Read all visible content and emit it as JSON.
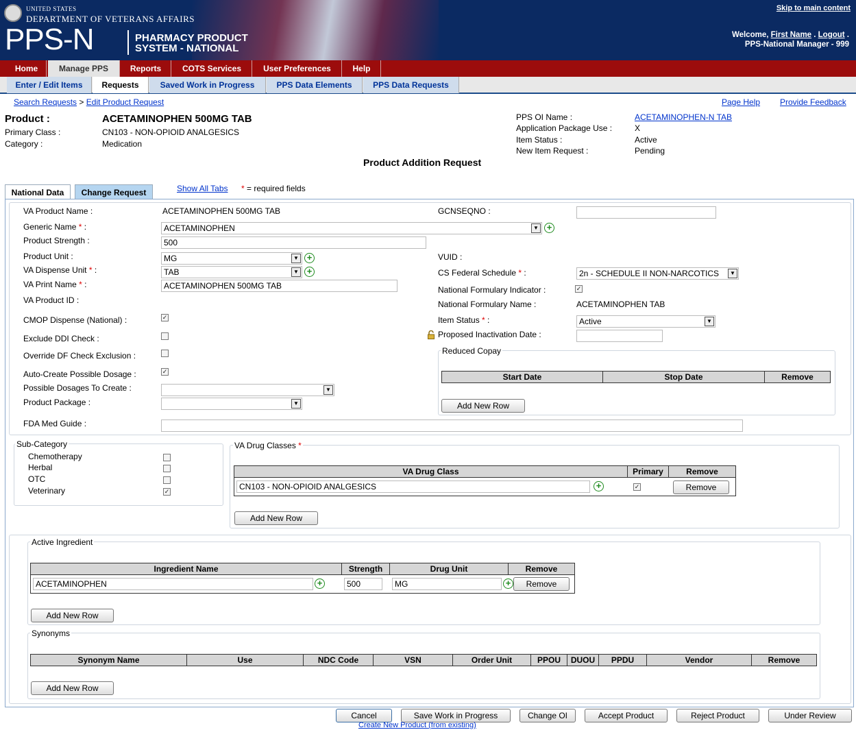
{
  "header": {
    "skip": "Skip to main content",
    "agency_small": "UNITED STATES",
    "agency": "DEPARTMENT OF VETERANS AFFAIRS",
    "logo": "PPS-N",
    "logo_sub1": "PHARMACY PRODUCT",
    "logo_sub2": "SYSTEM - NATIONAL",
    "welcome": "Welcome,",
    "user": "First Name",
    "logout": "Logout",
    "role": "PPS-National Manager - 999"
  },
  "nav": {
    "main": [
      "Home",
      "Manage PPS",
      "Reports",
      "COTS Services",
      "User Preferences",
      "Help"
    ],
    "sub": [
      "Enter / Edit Items",
      "Requests",
      "Saved Work in Progress",
      "PPS Data Elements",
      "PPS Data Requests"
    ]
  },
  "breadcrumb": {
    "link1": "Search Requests",
    "sep": ">",
    "link2": "Edit Product Request"
  },
  "links": {
    "help": "Page Help",
    "feedback": "Provide Feedback"
  },
  "product": {
    "label": "Product :",
    "name": "ACETAMINOPHEN 500MG TAB",
    "primary_class_label": "Primary Class :",
    "primary_class": "CN103 - NON-OPIOID ANALGESICS",
    "category_label": "Category :",
    "category": "Medication",
    "oi_name_label": "PPS OI Name :",
    "oi_name": "ACETAMINOPHEN-N TAB",
    "app_pkg_label": "Application Package Use :",
    "app_pkg": "X",
    "item_status_label": "Item Status :",
    "item_status": "Active",
    "new_item_label": "New Item Request :",
    "new_item": "Pending"
  },
  "page_title": "Product Addition Request",
  "tabs": {
    "national": "National Data",
    "change": "Change Request",
    "show_all": "Show All Tabs",
    "required_star": "*",
    "required_text": " = required fields"
  },
  "form": {
    "va_product_name_label": "VA Product Name :",
    "va_product_name": "ACETAMINOPHEN 500MG TAB",
    "generic_name_label": "Generic Name",
    "generic_name": "ACETAMINOPHEN",
    "product_strength_label": "Product Strength :",
    "product_strength": "500",
    "product_unit_label": "Product Unit :",
    "product_unit": "MG",
    "dispense_unit_label": "VA Dispense Unit",
    "dispense_unit": "TAB",
    "print_name_label": "VA Print Name",
    "print_name": "ACETAMINOPHEN 500MG TAB",
    "product_id_label": "VA Product ID :",
    "cmop_label": "CMOP Dispense (National) :",
    "exclude_ddi_label": "Exclude DDI Check :",
    "override_df_label": "Override DF Check Exclusion :",
    "auto_create_label": "Auto-Create Possible Dosage :",
    "possible_dosages_label": "Possible Dosages To Create :",
    "product_package_label": "Product Package :",
    "fda_label": "FDA Med Guide :",
    "gcnseqno_label": "GCNSEQNO :",
    "vuid_label": "VUID :",
    "cs_label": "CS Federal Schedule",
    "cs_value": "2n - SCHEDULE II NON-NARCOTICS",
    "nfi_label": "National Formulary Indicator :",
    "nfn_label": "National Formulary Name :",
    "nfn_value": "ACETAMINOPHEN TAB",
    "item_status_label": "Item Status",
    "item_status": "Active",
    "proposed_label": "Proposed Inactivation Date :",
    "reduced_copay": "Reduced Copay",
    "copay_cols": [
      "Start Date",
      "Stop Date",
      "Remove"
    ],
    "star": "*",
    "colon": " :"
  },
  "subcategory": {
    "legend": "Sub-Category",
    "items": [
      {
        "label": "Chemotherapy",
        "checked": false
      },
      {
        "label": "Herbal",
        "checked": false
      },
      {
        "label": "OTC",
        "checked": false
      },
      {
        "label": "Veterinary",
        "checked": true
      }
    ]
  },
  "drug_classes": {
    "legend": "VA Drug Classes",
    "cols": [
      "VA Drug Class",
      "Primary",
      "Remove"
    ],
    "row": "CN103 - NON-OPIOID ANALGESICS",
    "remove": "Remove"
  },
  "ingredient": {
    "legend": "Active Ingredient",
    "cols": [
      "Ingredient Name",
      "Strength",
      "Drug Unit",
      "Remove"
    ],
    "name": "ACETAMINOPHEN",
    "strength": "500",
    "unit": "MG",
    "remove": "Remove"
  },
  "synonyms": {
    "legend": "Synonyms",
    "cols": [
      "Synonym Name",
      "Use",
      "NDC Code",
      "VSN",
      "Order Unit",
      "PPOU",
      "DUOU",
      "PPDU",
      "Vendor",
      "Remove"
    ]
  },
  "buttons": {
    "add_row": "Add New Row",
    "cancel": "Cancel",
    "save": "Save Work in Progress",
    "change_oi": "Change OI",
    "accept": "Accept Product",
    "reject": "Reject Product",
    "review": "Under Review",
    "create_new": "Create New Product (from existing)"
  }
}
